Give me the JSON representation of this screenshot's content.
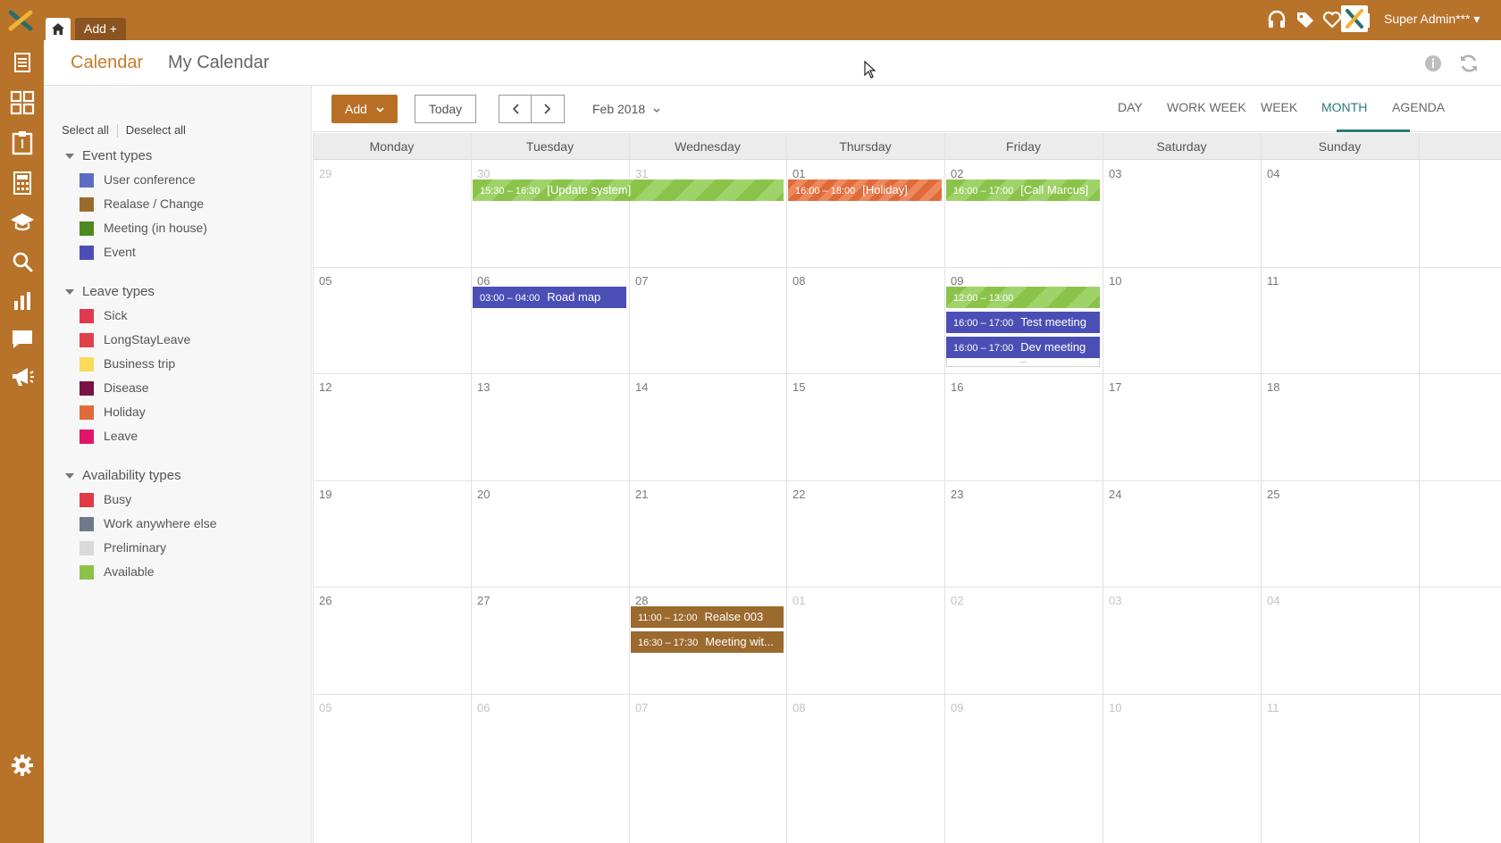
{
  "topbar": {
    "add_tab": "Add +",
    "user_name": "Super Admin*** ▾"
  },
  "header": {
    "tabs": [
      "Calendar",
      "My Calendar"
    ]
  },
  "sidebar": {
    "select_all": "Select all",
    "deselect_all": "Deselect all",
    "groups": [
      {
        "title": "Event types",
        "items": [
          {
            "label": "User conference",
            "color": "#5a6fc4"
          },
          {
            "label": "Realase / Change",
            "color": "#9b6a2e"
          },
          {
            "label": "Meeting (in house)",
            "color": "#4e8a1f"
          },
          {
            "label": "Event",
            "color": "#4b4fb5"
          }
        ]
      },
      {
        "title": "Leave types",
        "items": [
          {
            "label": "Sick",
            "color": "#e03a4f"
          },
          {
            "label": "LongStayLeave",
            "color": "#e0414a"
          },
          {
            "label": "Business trip",
            "color": "#f7dc5c"
          },
          {
            "label": "Disease",
            "color": "#7a1246"
          },
          {
            "label": "Holiday",
            "color": "#e06a3a"
          },
          {
            "label": "Leave",
            "color": "#e0146a"
          }
        ]
      },
      {
        "title": "Availability types",
        "items": [
          {
            "label": "Busy",
            "color": "#e03a46"
          },
          {
            "label": "Work anywhere else",
            "color": "#6e7a8a"
          },
          {
            "label": "Preliminary",
            "color": "#d9d9d9"
          },
          {
            "label": "Available",
            "color": "#8bc34a"
          }
        ]
      }
    ]
  },
  "toolbar": {
    "add_label": "Add",
    "today_label": "Today",
    "month_label": "Feb 2018",
    "views": [
      "DAY",
      "WORK WEEK",
      "WEEK",
      "MONTH",
      "AGENDA"
    ],
    "active_view": "MONTH"
  },
  "calendar": {
    "weekdays": [
      "Monday",
      "Tuesday",
      "Wednesday",
      "Thursday",
      "Friday",
      "Saturday",
      "Sunday"
    ],
    "weeks": [
      [
        {
          "d": "29",
          "other": true
        },
        {
          "d": "30",
          "other": true
        },
        {
          "d": "31",
          "other": true
        },
        {
          "d": "01"
        },
        {
          "d": "02"
        },
        {
          "d": "03"
        },
        {
          "d": "04"
        }
      ],
      [
        {
          "d": "05"
        },
        {
          "d": "06"
        },
        {
          "d": "07"
        },
        {
          "d": "08"
        },
        {
          "d": "09"
        },
        {
          "d": "10"
        },
        {
          "d": "11"
        }
      ],
      [
        {
          "d": "12"
        },
        {
          "d": "13"
        },
        {
          "d": "14"
        },
        {
          "d": "15"
        },
        {
          "d": "16"
        },
        {
          "d": "17"
        },
        {
          "d": "18"
        }
      ],
      [
        {
          "d": "19"
        },
        {
          "d": "20"
        },
        {
          "d": "21"
        },
        {
          "d": "22"
        },
        {
          "d": "23"
        },
        {
          "d": "24"
        },
        {
          "d": "25"
        }
      ],
      [
        {
          "d": "26"
        },
        {
          "d": "27"
        },
        {
          "d": "28"
        },
        {
          "d": "01",
          "other": true
        },
        {
          "d": "02",
          "other": true
        },
        {
          "d": "03",
          "other": true
        },
        {
          "d": "04",
          "other": true
        }
      ],
      [
        {
          "d": "05",
          "other": true
        },
        {
          "d": "06",
          "other": true
        },
        {
          "d": "07",
          "other": true
        },
        {
          "d": "08",
          "other": true
        },
        {
          "d": "09",
          "other": true
        },
        {
          "d": "10",
          "other": true
        },
        {
          "d": "11",
          "other": true
        }
      ]
    ],
    "events": [
      {
        "week": 0,
        "col": 1,
        "span": 2,
        "slot": 0,
        "style": "green",
        "time": "15:30 – 16:30",
        "title": "[Update system]"
      },
      {
        "week": 0,
        "col": 3,
        "span": 1,
        "slot": 0,
        "style": "orange",
        "time": "16:00 – 18:00",
        "title": "[Holiday]"
      },
      {
        "week": 0,
        "col": 4,
        "span": 1,
        "slot": 0,
        "style": "green",
        "time": "16:00 – 17:00",
        "title": "[Call Marcus]"
      },
      {
        "week": 1,
        "col": 1,
        "span": 1,
        "slot": 0,
        "style": "blue",
        "time": "03:00 – 04:00",
        "title": "Road map"
      },
      {
        "week": 1,
        "col": 4,
        "span": 1,
        "slot": 0,
        "style": "green",
        "time": "12:00 – 13:00",
        "title": ""
      },
      {
        "week": 1,
        "col": 4,
        "span": 1,
        "slot": 1,
        "style": "blue",
        "time": "16:00 – 17:00",
        "title": "Test meeting"
      },
      {
        "week": 1,
        "col": 4,
        "span": 1,
        "slot": 2,
        "style": "blue",
        "time": "16:00 – 17:00",
        "title": "Dev meeting"
      },
      {
        "week": 4,
        "col": 2,
        "span": 1,
        "slot": 0,
        "style": "brown",
        "time": "11:00 – 12:00",
        "title": "Realse 003"
      },
      {
        "week": 4,
        "col": 2,
        "span": 1,
        "slot": 1,
        "style": "brown",
        "time": "16:30 – 17:30",
        "title": "Meeting wit..."
      }
    ],
    "more_indicator": {
      "week": 1,
      "col": 4,
      "label": "..."
    }
  }
}
